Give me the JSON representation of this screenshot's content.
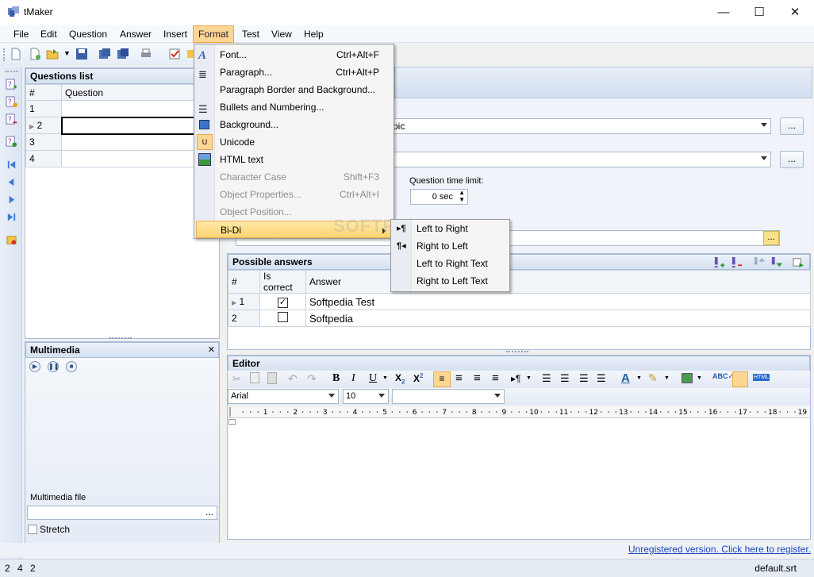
{
  "window": {
    "title": "tMaker",
    "minimize": "—",
    "maximize": "☐",
    "close": "✕"
  },
  "menubar": {
    "items": [
      "File",
      "Edit",
      "Question",
      "Answer",
      "Insert",
      "Format",
      "Test",
      "View",
      "Help"
    ],
    "active": "Format"
  },
  "questions_list": {
    "title": "Questions list",
    "columns": [
      "#",
      "Question"
    ],
    "rows": [
      "1",
      "2",
      "3",
      "4"
    ]
  },
  "multimedia": {
    "title": "Multimedia",
    "close": "✕",
    "file_label": "Multimedia file",
    "file_value": "",
    "file_button": "...",
    "stretch_label": "Stretch"
  },
  "question_settings": {
    "topic_fragment": "pic",
    "time_limit_label": "Question time limit:",
    "time_limit_value": "0 sec",
    "browse_button": "..."
  },
  "possible_answers": {
    "title": "Possible answers",
    "columns": [
      "#",
      "Is correct",
      "Answer"
    ],
    "rows": [
      {
        "num": "1",
        "correct": true,
        "answer": "Softpedia Test"
      },
      {
        "num": "2",
        "correct": false,
        "answer": "Softpedia"
      }
    ]
  },
  "editor": {
    "title": "Editor",
    "font": "Arial",
    "size": "10",
    "style": "",
    "ruler_marks": [
      "1",
      "2",
      "3",
      "4",
      "5",
      "6",
      "7",
      "8",
      "9",
      "10",
      "11",
      "12",
      "13",
      "14",
      "15",
      "16",
      "17",
      "18",
      "19"
    ]
  },
  "format_menu": {
    "items": [
      {
        "label": "Font...",
        "shortcut": "Ctrl+Alt+F",
        "disabled": false,
        "icon": "font-icon"
      },
      {
        "label": "Paragraph...",
        "shortcut": "Ctrl+Alt+P",
        "disabled": false,
        "icon": "paragraph-icon"
      },
      {
        "label": "Paragraph Border and Background...",
        "shortcut": "",
        "disabled": false,
        "icon": ""
      },
      {
        "label": "Bullets and Numbering...",
        "shortcut": "",
        "disabled": false,
        "icon": "bullets-icon"
      },
      {
        "label": "Background...",
        "shortcut": "",
        "disabled": false,
        "icon": "background-icon"
      },
      {
        "label": "Unicode",
        "shortcut": "",
        "disabled": false,
        "icon": "unicode-icon"
      },
      {
        "label": "HTML text",
        "shortcut": "",
        "disabled": false,
        "icon": "html-text-icon"
      },
      {
        "label": "Character Case",
        "shortcut": "Shift+F3",
        "disabled": true,
        "icon": ""
      },
      {
        "label": "Object Properties...",
        "shortcut": "Ctrl+Alt+I",
        "disabled": true,
        "icon": ""
      },
      {
        "label": "Object Position...",
        "shortcut": "",
        "disabled": true,
        "icon": ""
      },
      {
        "label": "Bi-Di",
        "shortcut": "",
        "disabled": false,
        "icon": "",
        "submenu": true
      }
    ]
  },
  "bidi_submenu": {
    "items": [
      "Left to Right",
      "Right to Left",
      "Left to Right Text",
      "Right to Left Text"
    ]
  },
  "status": {
    "link": "Unregistered version. Click here to register.",
    "left_values": [
      "2",
      "4",
      "2"
    ],
    "file": "default.srt"
  },
  "watermark": "SOFTPEDIA"
}
